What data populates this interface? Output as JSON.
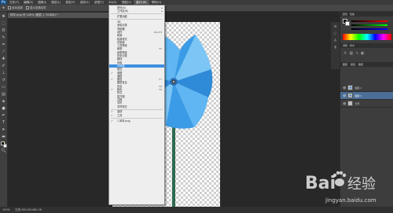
{
  "menubar": {
    "items": [
      {
        "label": "Ps"
      },
      {
        "label": "文件(F)"
      },
      {
        "label": "编辑(E)"
      },
      {
        "label": "图像(I)"
      },
      {
        "label": "图层(L)"
      },
      {
        "label": "类型(Y)"
      },
      {
        "label": "选择(S)"
      },
      {
        "label": "滤镜(T)"
      },
      {
        "label": "3D(D)"
      },
      {
        "label": "视图(V)"
      },
      {
        "label": "窗口(W)"
      },
      {
        "label": "帮助(H)"
      }
    ]
  },
  "optionsbar": {
    "auto_select": "自动选择",
    "transform_controls": "显示变换控件"
  },
  "document": {
    "tab_title": "风车.png @ 100% (图层 1, RGB/8) *",
    "zoom": "100%",
    "doc_size": "文档:360.0K/480.0K"
  },
  "window_menu": {
    "items": [
      {
        "label": "排列(A)",
        "submenu": true
      },
      {
        "label": "工作区(K)",
        "submenu": true
      },
      {
        "sep": true
      },
      {
        "label": "扩展功能"
      },
      {
        "sep": true
      },
      {
        "label": "3D"
      },
      {
        "label": "测量记录"
      },
      {
        "label": "导航器"
      },
      {
        "label": "动作",
        "shortcut": "Alt+F9"
      },
      {
        "label": "段落"
      },
      {
        "label": "段落样式"
      },
      {
        "label": "仿制源"
      },
      {
        "label": "工具预设"
      },
      {
        "label": "画笔",
        "shortcut": "F5"
      },
      {
        "label": "画笔预设"
      },
      {
        "label": "历史记录"
      },
      {
        "label": "路径"
      },
      {
        "label": "色板"
      },
      {
        "label": "时间轴",
        "highlight": true
      },
      {
        "label": "属性"
      },
      {
        "label": "调整",
        "checked": true
      },
      {
        "label": "通道"
      },
      {
        "label": "图层",
        "shortcut": "F7",
        "checked": true
      },
      {
        "label": "图层复合"
      },
      {
        "label": "信息",
        "shortcut": "F8"
      },
      {
        "label": "颜色",
        "shortcut": "F6",
        "checked": true
      },
      {
        "label": "样式"
      },
      {
        "label": "直方图"
      },
      {
        "label": "注释"
      },
      {
        "label": "字符"
      },
      {
        "label": "字符样式"
      },
      {
        "sep": true
      },
      {
        "label": "选项",
        "checked": true
      },
      {
        "label": "工具",
        "checked": true
      },
      {
        "sep": true
      },
      {
        "label": "1 风车.png",
        "checked": true
      }
    ]
  },
  "right_panel": {
    "color_tab": "颜色",
    "swatches_tab": "色板",
    "adjust_tab": "调整",
    "styles_tab": "样式",
    "layers_tab": "图层",
    "channels_tab": "通道",
    "paths_tab": "路径",
    "layers": [
      {
        "name": "图层 2"
      },
      {
        "name": "图层 1",
        "selected": true
      },
      {
        "name": "背景"
      }
    ]
  },
  "watermark": {
    "brand_text": "Bai 经验",
    "sub_text": "jingyan.baidu.com"
  },
  "colors": {
    "accent": "#3f8fe0",
    "pinwheel_blue": "#3b9be6",
    "stick_green": "#2e6b4f"
  }
}
